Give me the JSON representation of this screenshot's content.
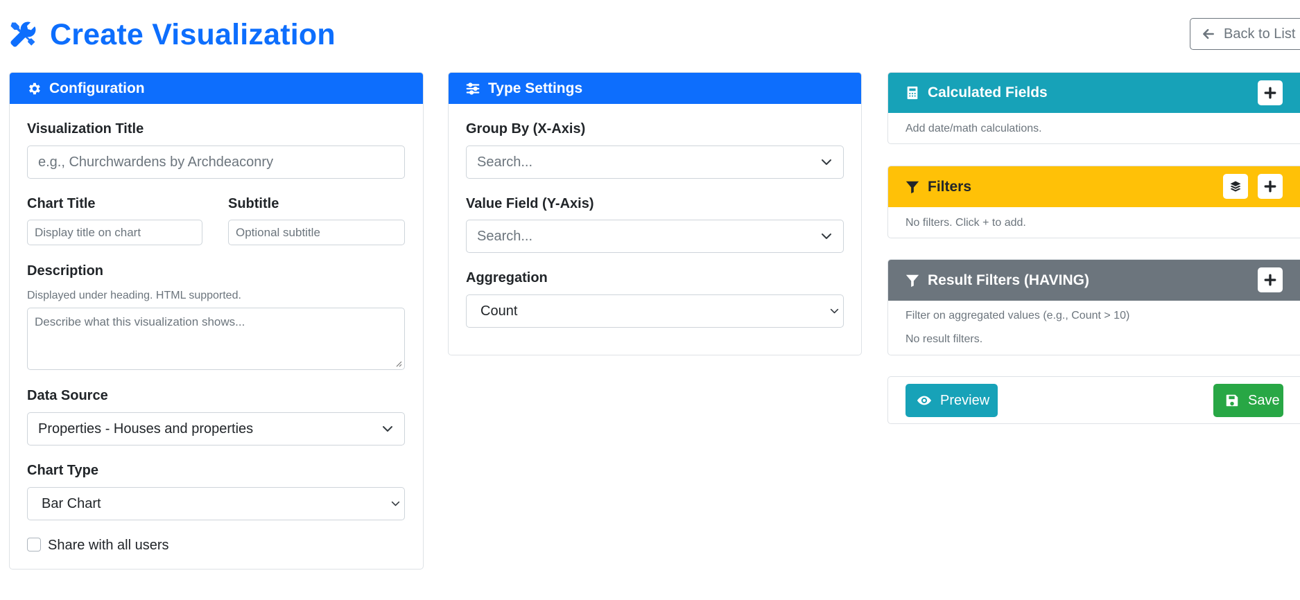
{
  "header": {
    "title": "Create Visualization",
    "title_icon": "tools-icon",
    "back_label": "Back to List"
  },
  "colors": {
    "primary": "#0d6efd",
    "info": "#17a2b8",
    "warning": "#ffc107",
    "secondary": "#6c757d",
    "success": "#28a745"
  },
  "config": {
    "heading": "Configuration",
    "viz_title_label": "Visualization Title",
    "viz_title_placeholder": "e.g., Churchwardens by Archdeaconry",
    "chart_title_label": "Chart Title",
    "chart_title_placeholder": "Display title on chart",
    "subtitle_label": "Subtitle",
    "subtitle_placeholder": "Optional subtitle",
    "description_label": "Description",
    "description_help": "Displayed under heading. HTML supported.",
    "description_placeholder": "Describe what this visualization shows...",
    "data_source_label": "Data Source",
    "data_source_value": "Properties - Houses and properties",
    "chart_type_label": "Chart Type",
    "chart_type_value": "Bar Chart",
    "share_label": "Share with all users",
    "share_checked": false
  },
  "type_settings": {
    "heading": "Type Settings",
    "group_by_label": "Group By (X-Axis)",
    "group_by_placeholder": "Search...",
    "value_field_label": "Value Field (Y-Axis)",
    "value_field_placeholder": "Search...",
    "aggregation_label": "Aggregation",
    "aggregation_value": "Count"
  },
  "calculated_fields": {
    "heading": "Calculated Fields",
    "text": "Add date/math calculations."
  },
  "filters": {
    "heading": "Filters",
    "text": "No filters. Click + to add."
  },
  "result_filters": {
    "heading": "Result Filters (HAVING)",
    "help": "Filter on aggregated values (e.g., Count > 10)",
    "text": "No result filters."
  },
  "actions": {
    "preview_label": "Preview",
    "save_label": "Save"
  }
}
